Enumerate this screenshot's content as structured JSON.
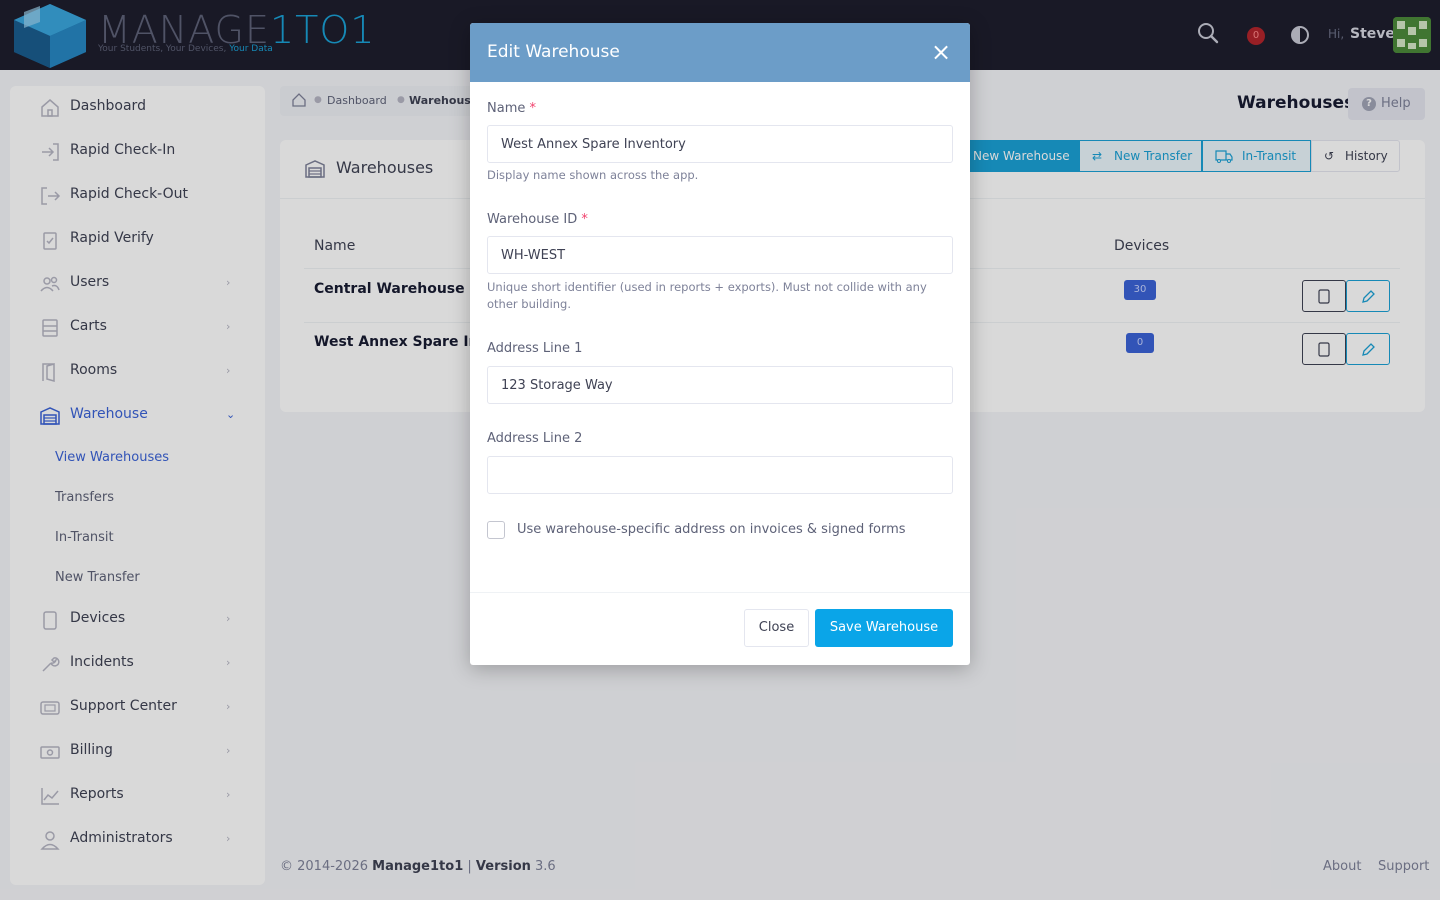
{
  "header": {
    "logo_main": "MANAGE",
    "logo_accent": "1TO1",
    "tagline_prefix": "Your Students, Your Devices,",
    "tagline_accent": "Your Data",
    "notification_count": "0",
    "greeting": "Hi,",
    "user_name": "Steve",
    "icons": [
      "search-icon",
      "bell-icon",
      "contrast-icon",
      "avatar"
    ]
  },
  "sidebar": {
    "items": [
      {
        "label": "Dashboard",
        "icon": "home-icon"
      },
      {
        "label": "Rapid Check-In",
        "icon": "sign-in-icon"
      },
      {
        "label": "Rapid Check-Out",
        "icon": "sign-out-icon"
      },
      {
        "label": "Rapid Verify",
        "icon": "clipboard-check-icon"
      },
      {
        "label": "Users",
        "icon": "users-icon"
      },
      {
        "label": "Carts",
        "icon": "cart-icon"
      },
      {
        "label": "Rooms",
        "icon": "door-icon"
      },
      {
        "label": "Warehouse",
        "icon": "warehouse-icon"
      },
      {
        "label": "Devices",
        "icon": "tablet-icon"
      },
      {
        "label": "Incidents",
        "icon": "wrench-icon"
      },
      {
        "label": "Support Center",
        "icon": "support-icon"
      },
      {
        "label": "Billing",
        "icon": "money-icon"
      },
      {
        "label": "Reports",
        "icon": "chart-icon"
      },
      {
        "label": "Administrators",
        "icon": "admin-icon"
      }
    ],
    "warehouse_sub": [
      "View Warehouses",
      "Transfers",
      "In-Transit",
      "New Transfer"
    ]
  },
  "breadcrumb": {
    "items": [
      "Dashboard",
      "Warehouse"
    ]
  },
  "page": {
    "title": "Warehouses",
    "help_label": "Help"
  },
  "card": {
    "title": "Warehouses",
    "buttons": [
      "New Warehouse",
      "New Transfer",
      "In-Transit",
      "History"
    ],
    "columns": {
      "name": "Name",
      "devices": "Devices"
    },
    "rows": [
      {
        "name": "Central Warehouse",
        "devices": "30"
      },
      {
        "name": "West Annex Spare Inver",
        "devices": "0"
      }
    ]
  },
  "footer": {
    "copyright": "© 2014-2026",
    "brand": "Manage1to1",
    "sep": "|",
    "version_label": "Version",
    "version": "3.6",
    "links": [
      "About",
      "Support"
    ]
  },
  "modal": {
    "title": "Edit Warehouse",
    "name_label": "Name",
    "name_value": "West Annex Spare Inventory",
    "name_help": "Display name shown across the app.",
    "id_label": "Warehouse ID",
    "id_value": "WH-WEST",
    "id_help": "Unique short identifier (used in reports + exports). Must not collide with any other building.",
    "addr1_label": "Address Line 1",
    "addr1_value": "123 Storage Way",
    "addr2_label": "Address Line 2",
    "addr2_value": "",
    "checkbox_label": "Use warehouse-specific address on invoices & signed forms",
    "checkbox_checked": false,
    "close_label": "Close",
    "save_label": "Save Warehouse",
    "required_mark": "*",
    "close_icon": "×"
  },
  "colors": {
    "header_bg": "#1e1e2d",
    "accent": "#1ba1d6",
    "modal_header": "#6c9dc8",
    "primary_button": "#0aa5e8",
    "active_nav": "#3b63d8"
  }
}
